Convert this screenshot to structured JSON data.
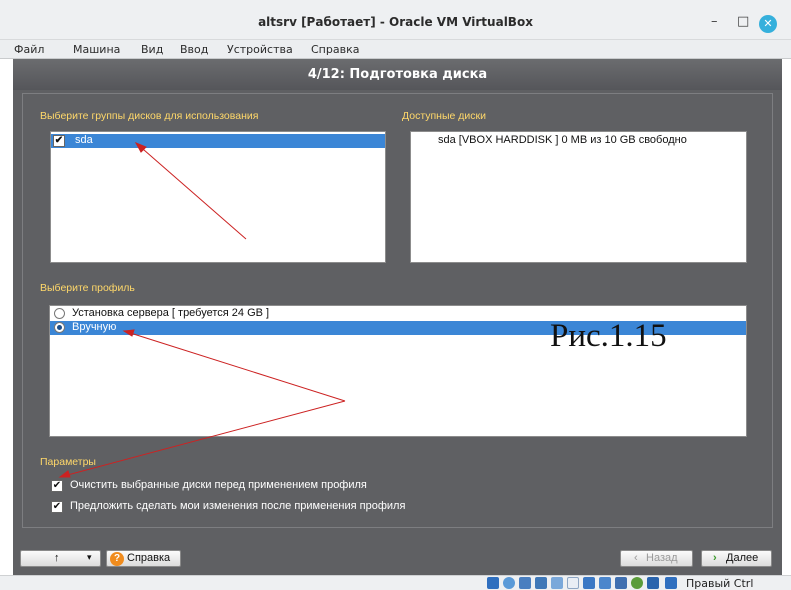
{
  "window": {
    "title": "altsrv [Работает] - Oracle VM VirtualBox",
    "controls": {
      "minimize": "–",
      "maximize": "□",
      "close": "✕"
    }
  },
  "menubar": [
    "Файл",
    "Машина",
    "Вид",
    "Ввод",
    "Устройства",
    "Справка"
  ],
  "installer": {
    "step_title": "4/12: Подготовка диска",
    "disk_groups": {
      "label": "Выберите группы дисков для использования",
      "items": [
        {
          "label": "sda",
          "checked": true,
          "selected": true
        }
      ]
    },
    "available_disks": {
      "label": "Доступные диски",
      "items": [
        "sda [VBOX HARDDISK   ] 0 MB из 10 GB свободно"
      ]
    },
    "profile": {
      "label": "Выберите профиль",
      "options": [
        {
          "label": "Установка сервера [ требуется 24 GB ]",
          "selected": false
        },
        {
          "label": "Вручную",
          "selected": true
        }
      ]
    },
    "params": {
      "label": "Параметры",
      "options": [
        {
          "label": "Очистить выбранные диски перед применением профиля",
          "checked": true
        },
        {
          "label": "Предложить сделать мои изменения после применения профиля",
          "checked": true
        }
      ]
    },
    "buttons": {
      "up": "↑",
      "dropdown": "▾",
      "help": "Справка",
      "back": "Назад",
      "next": "Далее"
    }
  },
  "annotation": {
    "figure_label": "Рис.1.15",
    "arrow_color": "#cc2222"
  },
  "statusbar": {
    "host_key": "Правый Ctrl"
  },
  "colors": {
    "accent_label": "#ffd86a",
    "selection": "#3b86d6",
    "vm_background": "#5f6063",
    "close_button": "#35b0dc"
  }
}
